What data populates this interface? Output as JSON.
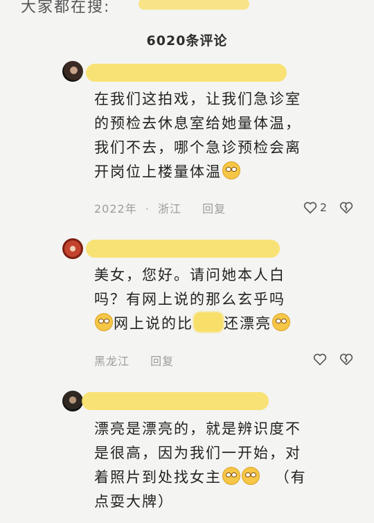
{
  "top": {
    "text": "大家都在搜:"
  },
  "comment_count": "6020条评论",
  "comments": [
    {
      "text_lines": [
        "在我们这拍戏，让我们急诊室",
        "的预检去休息室给她量体温，",
        "我们不去，哪个急诊预检会离",
        "开岗位上楼量体温"
      ],
      "emoji": "laughing-tears-emoji",
      "meta_year": "2022年",
      "meta_region": "浙江",
      "reply_label": "回复",
      "like_count": "2"
    },
    {
      "line1": "美女，您好。请问她本人白",
      "line2": "吗？有网上说的那么玄乎吗",
      "line3_before": "网上说的比",
      "line3_after": "还漂亮",
      "meta_region": "黑龙江",
      "reply_label": "回复"
    },
    {
      "text_lines": [
        "漂亮是漂亮的，就是辨识度不",
        "是很高，因为我们一开始，对"
      ],
      "line3": "着照片到处找女主",
      "line3_tail": "（有",
      "line4": "点耍大牌）"
    }
  ],
  "colors": {
    "highlight": "#f7df6a",
    "meta": "#9c9c9c",
    "background": "#f4f4f2"
  }
}
